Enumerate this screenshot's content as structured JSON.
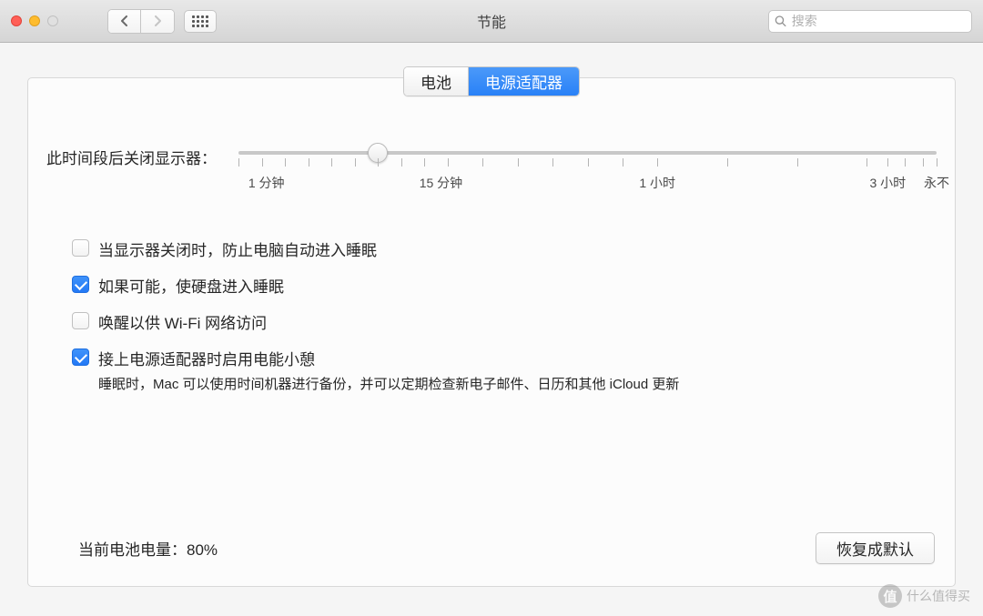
{
  "toolbar": {
    "title": "节能",
    "search_placeholder": "搜索"
  },
  "tabs": {
    "battery": "电池",
    "power_adapter": "电源适配器"
  },
  "slider": {
    "label": "此时间段后关闭显示器：",
    "tick_labels": {
      "min1": "1 分钟",
      "min15": "15 分钟",
      "hr1": "1 小时",
      "hr3": "3 小时",
      "never": "永不"
    }
  },
  "options": {
    "prevent_sleep": "当显示器关闭时，防止电脑自动进入睡眠",
    "disk_sleep": "如果可能，使硬盘进入睡眠",
    "wake_wifi": "唤醒以供 Wi-Fi 网络访问",
    "power_nap": "接上电源适配器时启用电能小憩",
    "power_nap_desc": "睡眠时，Mac 可以使用时间机器进行备份，并可以定期检查新电子邮件、日历和其他 iCloud 更新"
  },
  "footer": {
    "battery_status": "当前电池电量：80%",
    "restore_defaults": "恢复成默认"
  },
  "watermark": {
    "badge": "值",
    "text": "什么值得买"
  }
}
